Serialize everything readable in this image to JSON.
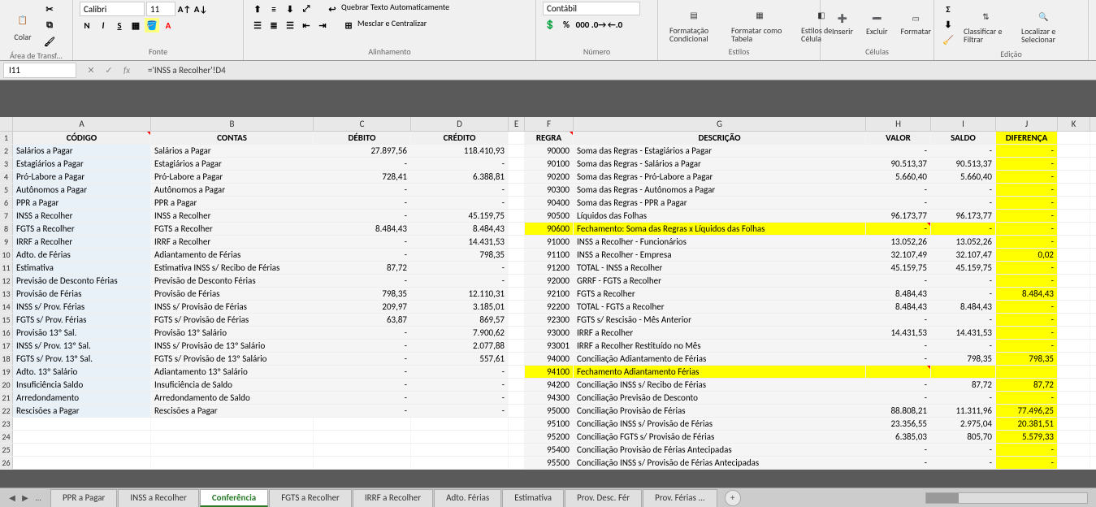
{
  "ribbon": {
    "clipboard": {
      "paste": "Colar",
      "group": "Área de Transf..."
    },
    "font": {
      "name": "Calibri",
      "size": "11",
      "group": "Fonte",
      "bold": "N",
      "italic": "I",
      "underline": "S"
    },
    "align": {
      "wrap": "Quebrar Texto Automaticamente",
      "merge": "Mesclar e Centralizar",
      "group": "Alinhamento"
    },
    "number": {
      "format": "Contábil",
      "group": "Número"
    },
    "styles": {
      "condfmt": "Formatação Condicional",
      "table": "Formatar como Tabela",
      "cellstyle": "Estilos de Célula",
      "group": "Estilos"
    },
    "cells": {
      "insert": "Inserir",
      "delete": "Excluir",
      "format": "Formatar",
      "group": "Células"
    },
    "edit": {
      "sort": "Classificar e Filtrar",
      "find": "Localizar e Selecionar",
      "group": "Edição"
    }
  },
  "formulabar": {
    "cellref": "I11",
    "formula": "='INSS a Recolher'!D4"
  },
  "headers": {
    "a": "CÓDIGO",
    "b": "CONTAS",
    "c": "DÉBITO",
    "d": "CRÉDITO",
    "f": "REGRA",
    "g": "DESCRIÇÃO",
    "h": "VALOR",
    "i": "SALDO",
    "j": "DIFERENÇA"
  },
  "cols": [
    "A",
    "B",
    "C",
    "D",
    "E",
    "F",
    "G",
    "H",
    "I",
    "J",
    "K"
  ],
  "left": [
    {
      "a": "Salários a Pagar",
      "b": "Salários a Pagar",
      "c": "27.897,56",
      "d": "118.410,93"
    },
    {
      "a": "Estagiários a Pagar",
      "b": "Estagiários a Pagar",
      "c": "-",
      "d": "-"
    },
    {
      "a": "Pró-Labore a Pagar",
      "b": "Pró-Labore a Pagar",
      "c": "728,41",
      "d": "6.388,81"
    },
    {
      "a": "Autônomos a Pagar",
      "b": "Autônomos a Pagar",
      "c": "-",
      "d": "-"
    },
    {
      "a": "PPR a Pagar",
      "b": "PPR a Pagar",
      "c": "-",
      "d": "-"
    },
    {
      "a": "INSS a Recolher",
      "b": "INSS a Recolher",
      "c": "-",
      "d": "45.159,75"
    },
    {
      "a": "FGTS a Recolher",
      "b": "FGTS a Recolher",
      "c": "8.484,43",
      "d": "8.484,43"
    },
    {
      "a": "IRRF a Recolher",
      "b": "IRRF a Recolher",
      "c": "-",
      "d": "14.431,53"
    },
    {
      "a": "Adto. de Férias",
      "b": "Adiantamento de Férias",
      "c": "-",
      "d": "798,35"
    },
    {
      "a": "Estimativa",
      "b": "Estimativa INSS s/ Recibo de Férias",
      "c": "87,72",
      "d": "-"
    },
    {
      "a": "Previsão de Desconto Férias",
      "b": "Previsão de Desconto Férias",
      "c": "-",
      "d": "-"
    },
    {
      "a": "Provisão de Férias",
      "b": "Provisão de Férias",
      "c": "798,35",
      "d": "12.110,31"
    },
    {
      "a": "INSS s/ Prov. Férias",
      "b": "INSS s/ Provisão de Férias",
      "c": "209,97",
      "d": "3.185,01"
    },
    {
      "a": "FGTS s/ Prov. Férias",
      "b": "FGTS s/ Provisão de Férias",
      "c": "63,87",
      "d": "869,57"
    },
    {
      "a": "Provisão 13º Sal.",
      "b": "Provisão 13º Salário",
      "c": "-",
      "d": "7.900,62"
    },
    {
      "a": "INSS s/ Prov. 13º Sal.",
      "b": "INSS s/ Provisão de 13º Salário",
      "c": "-",
      "d": "2.077,88"
    },
    {
      "a": "FGTS s/ Prov. 13º Sal.",
      "b": "FGTS s/ Provisão de 13º Salário",
      "c": "-",
      "d": "557,61"
    },
    {
      "a": "Adto. 13º Salário",
      "b": "Adiantamento 13º Salário",
      "c": "-",
      "d": "-"
    },
    {
      "a": "Insuficiência Saldo",
      "b": "Insuficiência de Saldo",
      "c": "-",
      "d": "-"
    },
    {
      "a": "Arredondamento",
      "b": "Arredondamento de Saldo",
      "c": "-",
      "d": "-"
    },
    {
      "a": "Rescisões a Pagar",
      "b": "Rescisões a Pagar",
      "c": "-",
      "d": "-"
    }
  ],
  "right": [
    {
      "f": "90000",
      "g": "Soma das Regras - Estagiários a Pagar",
      "h": "-",
      "i": "-",
      "j": "-"
    },
    {
      "f": "90100",
      "g": "Soma das Regras - Salários a Pagar",
      "h": "90.513,37",
      "i": "90.513,37",
      "j": "-"
    },
    {
      "f": "90200",
      "g": "Soma das Regras - Pró-Labore a Pagar",
      "h": "5.660,40",
      "i": "5.660,40",
      "j": "-"
    },
    {
      "f": "90300",
      "g": "Soma das Regras - Autônomos a Pagar",
      "h": "-",
      "i": "-",
      "j": "-"
    },
    {
      "f": "90400",
      "g": "Soma das Regras - PPR a Pagar",
      "h": "-",
      "i": "-",
      "j": "-"
    },
    {
      "f": "90500",
      "g": "Líquidos das Folhas",
      "h": "96.173,77",
      "i": "96.173,77",
      "j": "-"
    },
    {
      "f": "90600",
      "g": "Fechamento: Soma das Regras x Líquidos das Folhas",
      "h": "-",
      "i": "-",
      "j": "-",
      "yellow": true
    },
    {
      "f": "91000",
      "g": "INSS a Recolher - Funcionários",
      "h": "13.052,26",
      "i": "13.052,26",
      "j": "-"
    },
    {
      "f": "91100",
      "g": "INSS a Recolher - Empresa",
      "h": "32.107,49",
      "i": "32.107,47",
      "j": "0,02"
    },
    {
      "f": "91200",
      "g": "TOTAL - INSS a Recolher",
      "h": "45.159,75",
      "i": "45.159,75",
      "j": "-"
    },
    {
      "f": "92000",
      "g": "GRRF - FGTS a Recolher",
      "h": "-",
      "i": "-",
      "j": "-"
    },
    {
      "f": "92100",
      "g": "FGTS a Recolher",
      "h": "8.484,43",
      "i": "-",
      "j": "8.484,43"
    },
    {
      "f": "92200",
      "g": "TOTAL - FGTS a Recolher",
      "h": "8.484,43",
      "i": "8.484,43",
      "j": "-"
    },
    {
      "f": "92300",
      "g": "FGTS s/ Rescisão - Mês Anterior",
      "h": "-",
      "i": "-",
      "j": "-"
    },
    {
      "f": "93000",
      "g": "IRRF a Recolher",
      "h": "14.431,53",
      "i": "14.431,53",
      "j": "-"
    },
    {
      "f": "93001",
      "g": "IRRF a Recolher Restituído no Mês",
      "h": "-",
      "i": "-",
      "j": "-"
    },
    {
      "f": "94000",
      "g": "Conciliação Adiantamento de Férias",
      "h": "-",
      "i": "798,35",
      "j": "798,35"
    },
    {
      "f": "94100",
      "g": "Fechamento Adiantamento Férias",
      "h": "",
      "i": "",
      "j": "",
      "yellow": true
    },
    {
      "f": "94200",
      "g": "Conciliação INSS s/ Recibo de Férias",
      "h": "-",
      "i": "87,72",
      "j": "87,72"
    },
    {
      "f": "94300",
      "g": "Conciliação Previsão de Desconto",
      "h": "-",
      "i": "-",
      "j": "-"
    },
    {
      "f": "95000",
      "g": "Conciliação Provisão de Férias",
      "h": "88.808,21",
      "i": "11.311,96",
      "j": "77.496,25"
    },
    {
      "f": "95100",
      "g": "Conciliação INSS s/ Provisão de Férias",
      "h": "23.356,55",
      "i": "2.975,04",
      "j": "20.381,51"
    },
    {
      "f": "95200",
      "g": "Conciliação FGTS s/ Provisão de Férias",
      "h": "6.385,03",
      "i": "805,70",
      "j": "5.579,33"
    },
    {
      "f": "95400",
      "g": "Conciliação Provisão de Férias Antecipadas",
      "h": "-",
      "i": "-",
      "j": "-"
    },
    {
      "f": "95500",
      "g": "Conciliação INSS s/ Provisão de Férias Antecipadas",
      "h": "-",
      "i": "-",
      "j": "-"
    }
  ],
  "tabs": {
    "list": [
      "PPR a Pagar",
      "INSS a Recolher",
      "Conferência",
      "FGTS a Recolher",
      "IRRF a Recolher",
      "Adto. Férias",
      "Estimativa",
      "Prov. Desc. Fér",
      "Prov. Férias ..."
    ],
    "active": 2,
    "ellipsis": "..."
  }
}
